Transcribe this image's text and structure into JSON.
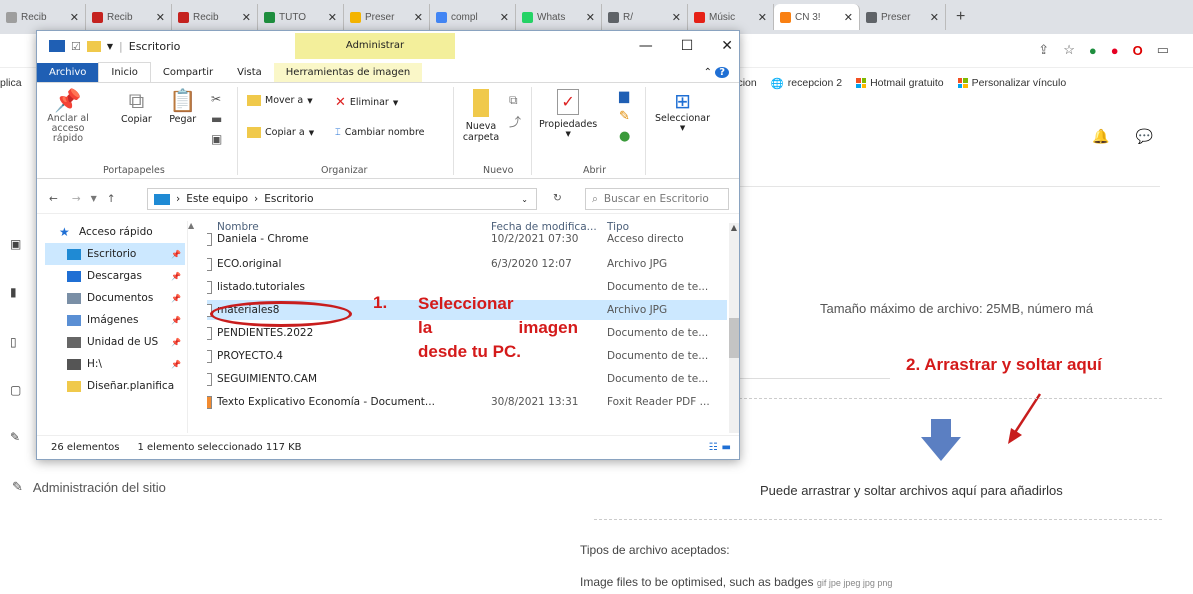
{
  "browser": {
    "tabs": [
      {
        "label": "Recib",
        "color": "#9e9e9e"
      },
      {
        "label": "Recib",
        "color": "#c5221f"
      },
      {
        "label": "Recib",
        "color": "#c5221f"
      },
      {
        "label": "TUTO",
        "color": "#1e8e3e"
      },
      {
        "label": "Preser",
        "color": "#f4b400"
      },
      {
        "label": "compl",
        "color": "#4285f4"
      },
      {
        "label": "Whats",
        "color": "#25d366"
      },
      {
        "label": "R/",
        "color": "#5f6368"
      },
      {
        "label": "Músic",
        "color": "#e62117"
      },
      {
        "label": "CN 3!",
        "color": "#f98012"
      },
      {
        "label": "Preser",
        "color": "#5f6368"
      }
    ],
    "new_tab": "+",
    "bookmarks": {
      "left_fragment": "plica",
      "items": [
        "pcion",
        "recepcion 2",
        "Hotmail gratuito",
        "Personalizar vínculo"
      ]
    }
  },
  "explorer": {
    "title": "Escritorio",
    "contextual_tab": "Administrar",
    "ribbon_tabs": [
      "Archivo",
      "Inicio",
      "Compartir",
      "Vista",
      "Herramientas de imagen"
    ],
    "clipboard": {
      "pin": "Anclar al acceso rápido",
      "copy": "Copiar",
      "paste": "Pegar",
      "label": "Portapapeles"
    },
    "organize": {
      "move": "Mover a",
      "copy_to": "Copiar a",
      "delete": "Eliminar",
      "rename": "Cambiar nombre",
      "label": "Organizar"
    },
    "new_group": {
      "new_folder": "Nueva carpeta",
      "label": "Nuevo"
    },
    "open_group": {
      "properties": "Propiedades",
      "label": "Abrir"
    },
    "select_group": {
      "select": "Seleccionar"
    },
    "path": [
      "Este equipo",
      "Escritorio"
    ],
    "search_placeholder": "Buscar en Escritorio",
    "sidebar": [
      {
        "label": "Acceso rápido",
        "icon": "star-icon"
      },
      {
        "label": "Escritorio",
        "icon": "desktop-folder-icon"
      },
      {
        "label": "Descargas",
        "icon": "download-icon"
      },
      {
        "label": "Documentos",
        "icon": "documents-icon"
      },
      {
        "label": "Imágenes",
        "icon": "images-icon"
      },
      {
        "label": "Unidad de US",
        "icon": "usb-drive-icon"
      },
      {
        "label": "H:\\",
        "icon": "drive-icon"
      },
      {
        "label": "Diseñar.planifica",
        "icon": "folder-icon"
      }
    ],
    "columns": [
      "Nombre",
      "Fecha de modifica...",
      "Tipo"
    ],
    "files": [
      {
        "name": "Daniela - Chrome",
        "date": "10/2/2021 07:30",
        "type": "Acceso directo"
      },
      {
        "name": "ECO.original",
        "date": "6/3/2020 12:07",
        "type": "Archivo JPG"
      },
      {
        "name": "listado.tutoriales",
        "date": "",
        "type": "Documento de te..."
      },
      {
        "name": "materiales8",
        "date": "",
        "type": "Archivo JPG"
      },
      {
        "name": "PENDIENTES.2022",
        "date": "",
        "type": "Documento de te..."
      },
      {
        "name": "PROYECTO.4",
        "date": "",
        "type": "Documento de te..."
      },
      {
        "name": "SEGUIMIENTO.CAM",
        "date": "",
        "type": "Documento de te..."
      },
      {
        "name": "Texto Explicativo Economía - Document...",
        "date": "30/8/2021 13:31",
        "type": "Foxit Reader PDF ..."
      }
    ],
    "status": {
      "count": "26 elementos",
      "selection": "1 elemento seleccionado  117 KB"
    }
  },
  "annotations": {
    "step1_number": "1.",
    "step1_lines": [
      "Seleccionar",
      "la imagen",
      "desde tu PC."
    ],
    "step2": "2. Arrastrar y soltar aquí",
    "color": "#d41a1a"
  },
  "page": {
    "admin_site": "Administración del sitio",
    "max_size": "Tamaño máximo de archivo: 25MB, número má",
    "drop_text": "Puede arrastrar y soltar archivos aquí para añadirlos",
    "accepted_title": "Tipos de archivo aceptados:",
    "accepted_desc": "Image files to be optimised, such as badges",
    "accepted_ext": "gif jpe jpeg jpg png"
  }
}
